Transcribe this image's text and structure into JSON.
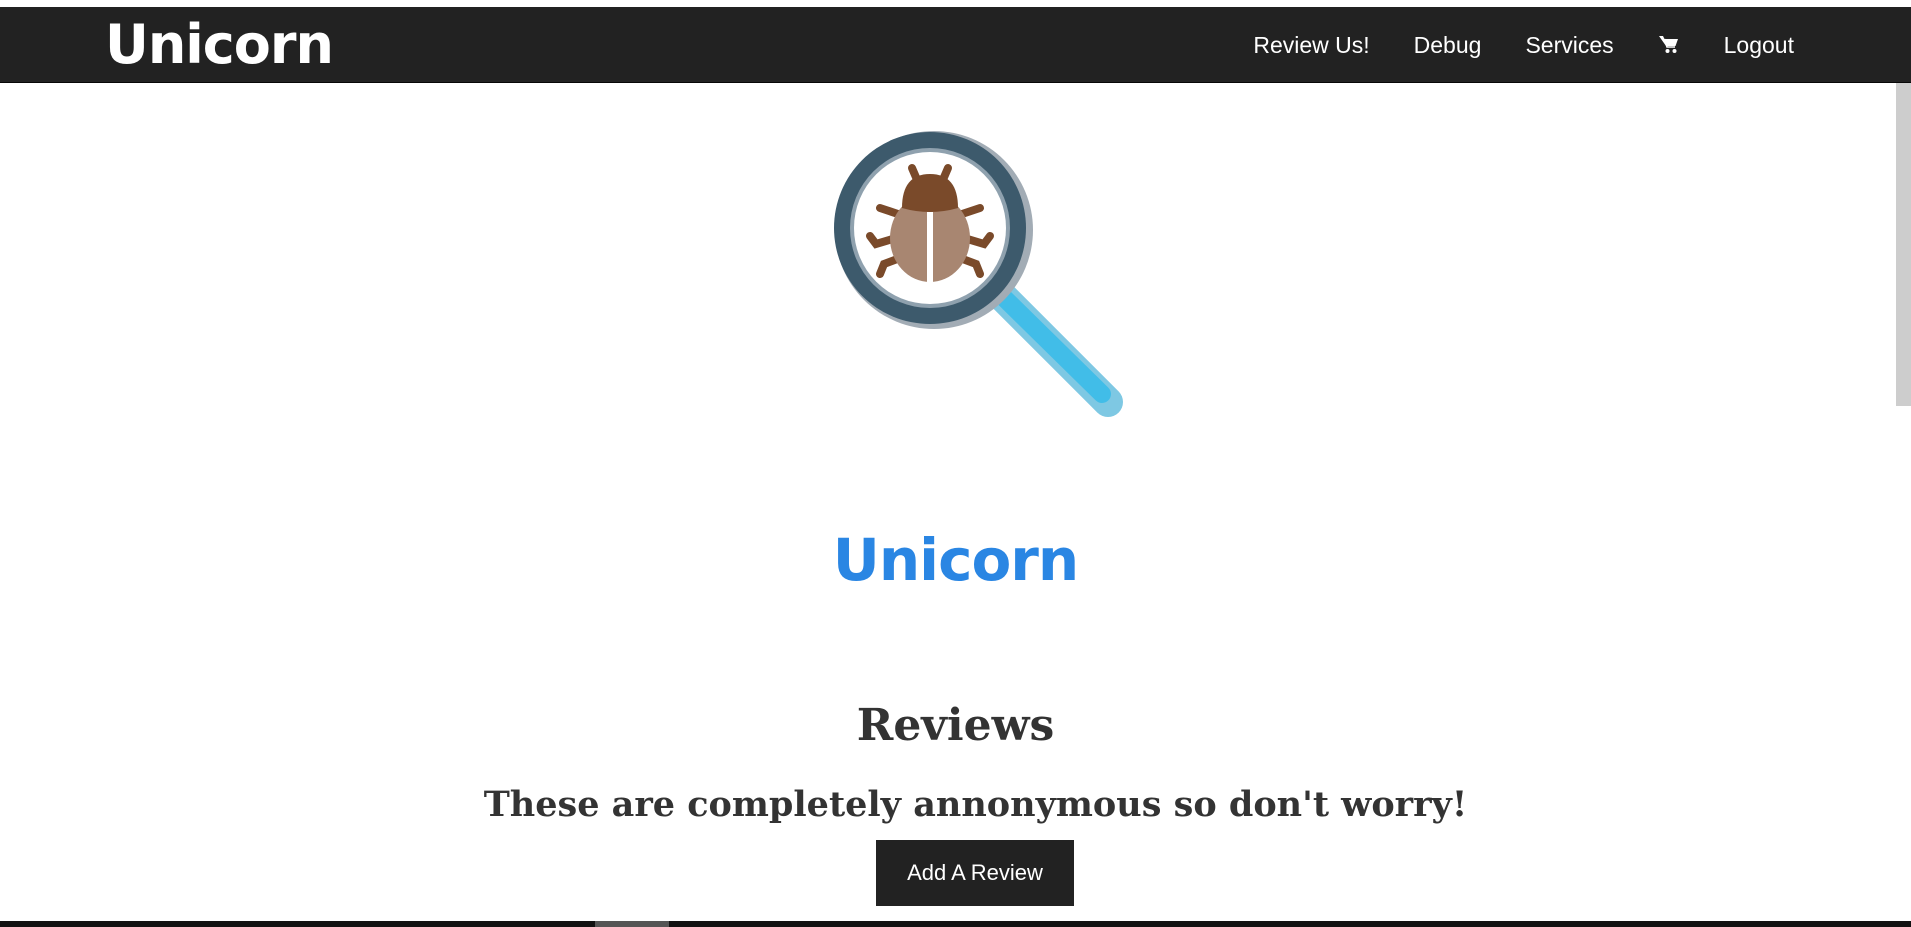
{
  "navbar": {
    "brand": "Unicorn",
    "links": [
      {
        "label": "Review Us!"
      },
      {
        "label": "Debug"
      },
      {
        "label": "Services"
      },
      {
        "label": "Logout"
      }
    ],
    "cart_icon": "shopping-cart-icon"
  },
  "hero": {
    "logo_icon": "magnifier-bug-icon",
    "title": "Unicorn",
    "title_color": "#2a86e3"
  },
  "reviews": {
    "heading": "Reviews",
    "subheading": "These are completely annonymous so don't worry!",
    "add_button_label": "Add A Review"
  },
  "colors": {
    "navbar_bg": "#222222",
    "accent": "#2a86e3",
    "text": "#333333"
  }
}
